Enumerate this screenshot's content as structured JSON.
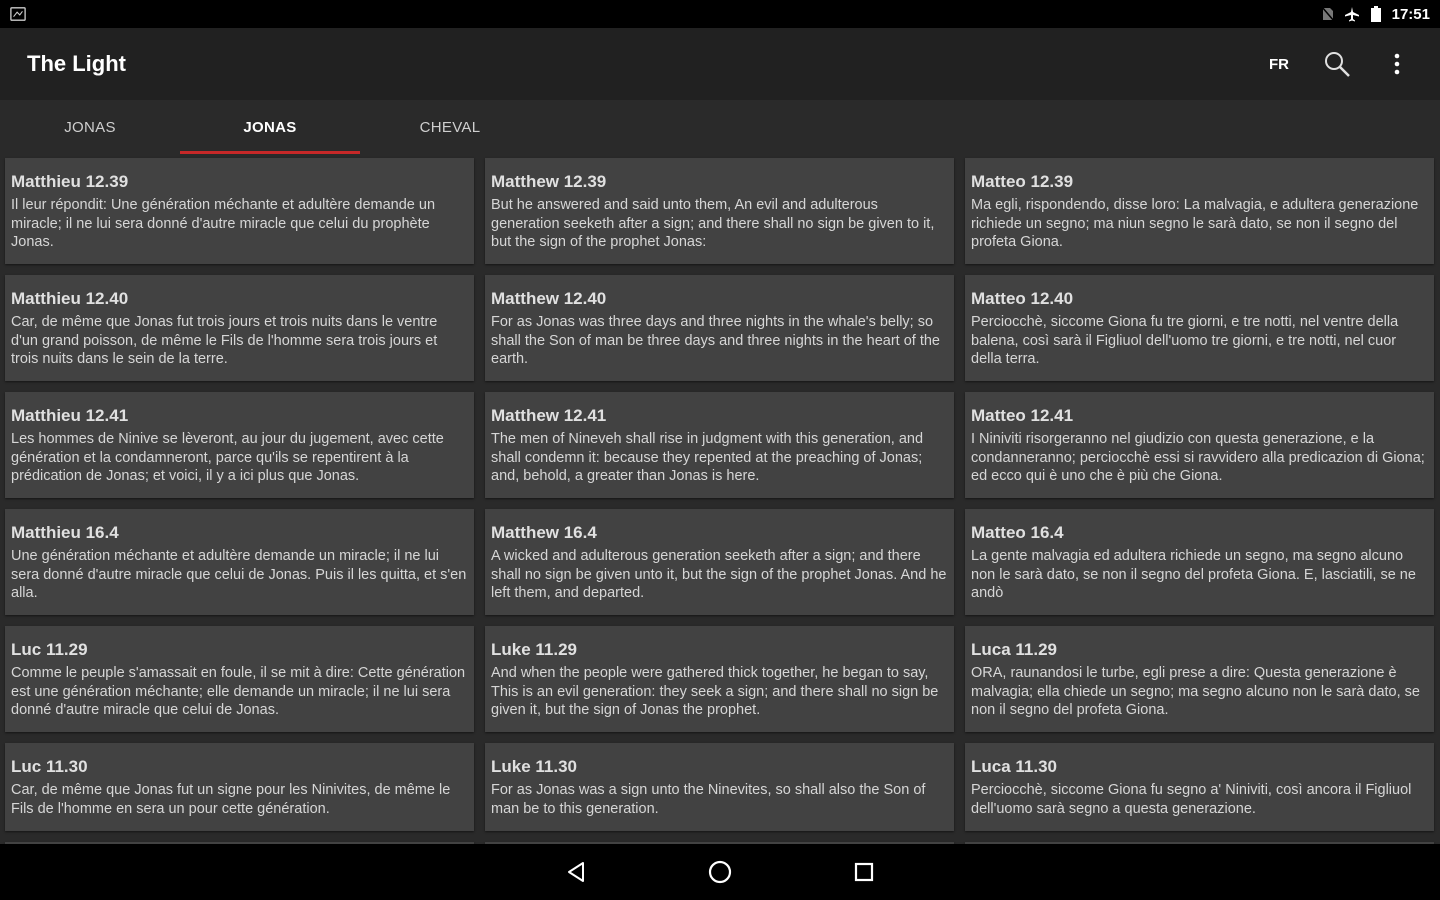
{
  "status_bar": {
    "time": "17:51",
    "icons": [
      "app-icon",
      "no-sim-icon",
      "airplane-icon",
      "battery-icon"
    ]
  },
  "app_bar": {
    "title": "The Light",
    "language": "FR",
    "icons": [
      "search-icon",
      "overflow-menu-icon"
    ]
  },
  "tabs": [
    {
      "label": "JONAS",
      "active": false
    },
    {
      "label": "JONAS",
      "active": true
    },
    {
      "label": "CHEVAL",
      "active": false
    }
  ],
  "rows": [
    {
      "fr": {
        "ref": "Matthieu 12.39",
        "text": "Il leur répondit: Une génération méchante et adultère demande un miracle; il ne lui sera donné d'autre miracle que celui du prophète Jonas."
      },
      "en": {
        "ref": "Matthew 12.39",
        "text": "But he answered and said unto them, An evil and adulterous generation seeketh after a sign; and there shall no sign be given to it, but the sign of the prophet Jonas:"
      },
      "it": {
        "ref": "Matteo 12.39",
        "text": "Ma egli, rispondendo, disse loro: La malvagia, e adultera generazione richiede un segno; ma niun segno le sarà dato, se non il segno del profeta Giona."
      }
    },
    {
      "fr": {
        "ref": "Matthieu 12.40",
        "text": "Car, de même que Jonas fut trois jours et trois nuits dans le ventre d'un grand poisson, de même le Fils de l'homme sera trois jours et trois nuits dans le sein de la terre."
      },
      "en": {
        "ref": "Matthew 12.40",
        "text": "For as Jonas was three days and three nights in the whale's belly; so shall the Son of man be three days and three nights in the heart of the earth."
      },
      "it": {
        "ref": "Matteo 12.40",
        "text": "Perciocchè, siccome Giona fu tre giorni, e tre notti, nel ventre della balena, così sarà il Figliuol dell'uomo tre giorni, e tre notti, nel cuor della terra."
      }
    },
    {
      "fr": {
        "ref": "Matthieu 12.41",
        "text": "Les hommes de Ninive se lèveront, au jour du jugement, avec cette génération et la condamneront, parce qu'ils se repentirent à la prédication de Jonas; et voici, il y a ici plus que Jonas."
      },
      "en": {
        "ref": "Matthew 12.41",
        "text": "The men of Nineveh shall rise in judgment with this generation, and shall condemn it: because they repented at the preaching of Jonas; and, behold, a greater than Jonas is here."
      },
      "it": {
        "ref": "Matteo 12.41",
        "text": "I Niniviti risorgeranno nel giudizio con questa generazione, e la condanneranno; perciocchè essi si ravvidero alla predicazion di Giona; ed ecco qui è uno che è più che Giona."
      }
    },
    {
      "fr": {
        "ref": "Matthieu 16.4",
        "text": "Une génération méchante et adultère demande un miracle; il ne lui sera donné d'autre miracle que celui de Jonas. Puis il les quitta, et s'en alla."
      },
      "en": {
        "ref": "Matthew 16.4",
        "text": "A wicked and adulterous generation seeketh after a sign; and there shall no sign be given unto it, but the sign of the prophet Jonas. And he left them, and departed."
      },
      "it": {
        "ref": "Matteo 16.4",
        "text": "La gente malvagia ed adultera richiede un segno, ma segno alcuno non le sarà dato, se non il segno del profeta Giona. E, lasciatili, se ne andò"
      }
    },
    {
      "fr": {
        "ref": "Luc 11.29",
        "text": "Comme le peuple s'amassait en foule, il se mit à dire: Cette génération est une génération méchante; elle demande un miracle; il ne lui sera donné d'autre miracle que celui de Jonas."
      },
      "en": {
        "ref": "Luke 11.29",
        "text": "And when the people were gathered thick together, he began to say, This is an evil generation: they seek a sign; and there shall no sign be given it, but the sign of Jonas the prophet."
      },
      "it": {
        "ref": "Luca 11.29",
        "text": "ORA, raunandosi le turbe, egli prese a dire: Questa generazione è malvagia; ella chiede un segno; ma segno alcuno non le sarà dato, se non il segno del profeta Giona."
      }
    },
    {
      "fr": {
        "ref": "Luc 11.30",
        "text": "Car, de même que Jonas fut un signe pour les Ninivites, de même le Fils de l'homme en sera un pour cette génération."
      },
      "en": {
        "ref": "Luke 11.30",
        "text": "For as Jonas was a sign unto the Ninevites, so shall also the Son of man be to this generation."
      },
      "it": {
        "ref": "Luca 11.30",
        "text": "Perciocchè, siccome Giona fu segno a' Niniviti, così ancora il Figliuol dell'uomo sarà segno a questa generazione."
      }
    }
  ],
  "nav_bar": {
    "icons": [
      "back-icon",
      "home-icon",
      "recents-icon"
    ]
  },
  "colors": {
    "accent": "#c62828",
    "app_bar": "#212121",
    "background": "#2a2a2a",
    "card": "#424242"
  }
}
